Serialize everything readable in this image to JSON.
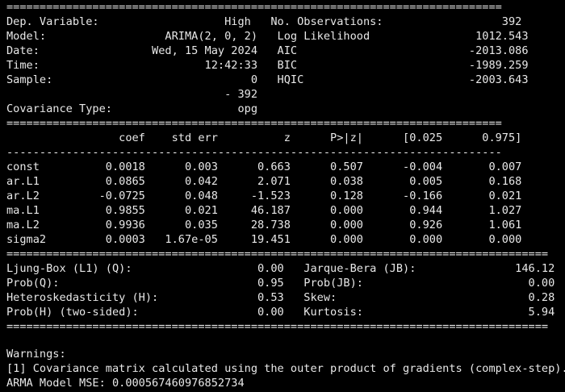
{
  "console": {
    "separator_double": "===========================================================================",
    "separator_single": "---------------------------------------------------------------------------",
    "separator_double_wide": "==================================================================================",
    "header": [
      "Dep. Variable:                   High   No. Observations:                  392",
      "Model:                  ARIMA(2, 0, 2)   Log Likelihood                1012.543",
      "Date:                 Wed, 15 May 2024   AIC                          -2013.086",
      "Time:                         12:42:33   BIC                          -1989.259",
      "Sample:                              0   HQIC                         -2003.643",
      "                                 - 392                                        ",
      "Covariance Type:                   opg                                        "
    ],
    "coef_header": "                 coef    std err          z      P>|z|      [0.025      0.975]",
    "coef_rows": [
      "const          0.0018      0.003      0.663      0.507      -0.004       0.007",
      "ar.L1          0.0865      0.042      2.071      0.038       0.005       0.168",
      "ar.L2         -0.0725      0.048     -1.523      0.128      -0.166       0.021",
      "ma.L1          0.9855      0.021     46.187      0.000       0.944       1.027",
      "ma.L2          0.9936      0.035     28.738      0.000       0.926       1.061",
      "sigma2         0.0003   1.67e-05     19.451      0.000       0.000       0.000"
    ],
    "diagnostics": [
      "Ljung-Box (L1) (Q):                   0.00   Jarque-Bera (JB):               146.12",
      "Prob(Q):                              0.95   Prob(JB):                         0.00",
      "Heteroskedasticity (H):               0.53   Skew:                             0.28",
      "Prob(H) (two-sided):                  0.00   Kurtosis:                         5.94"
    ],
    "warnings_title": "Warnings:",
    "warnings": [
      "[1] Covariance matrix calculated using the outer product of gradients (complex-step)."
    ],
    "mse_line": "ARMA Model MSE: 0.000567460976852734"
  }
}
